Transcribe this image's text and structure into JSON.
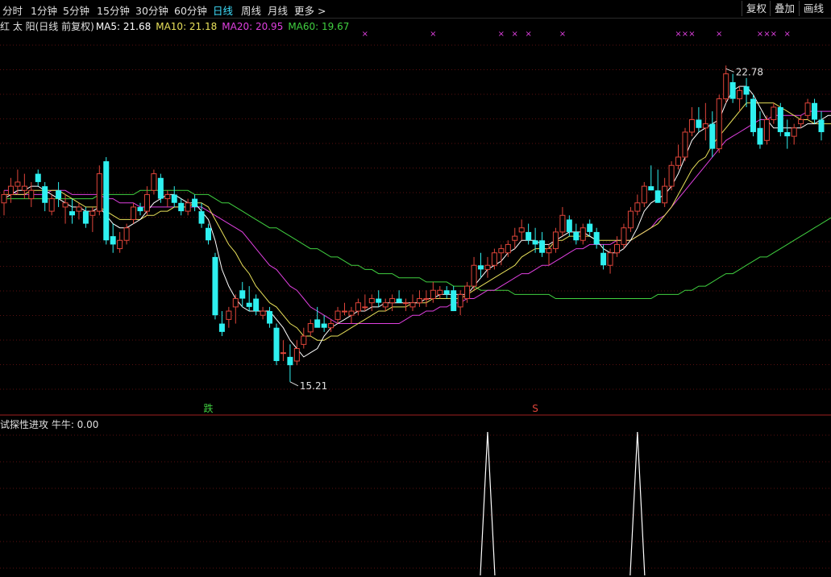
{
  "toolbar": {
    "timeframes": [
      "分时",
      "1分钟",
      "5分钟",
      "15分钟",
      "30分钟",
      "60分钟",
      "日线",
      "周线",
      "月线",
      "更多 >"
    ],
    "active": "日线",
    "right_buttons": [
      "复权",
      "叠加",
      "画线"
    ]
  },
  "main_legend": {
    "name": "红 太 阳(日线 前复权)",
    "ma5": "MA5: 21.68",
    "ma10": "MA10: 21.18",
    "ma20": "MA20: 20.95",
    "ma60": "MA60: 19.67"
  },
  "sub_legend": {
    "label": "试探性进攻 牛牛: 0.00"
  },
  "colors": {
    "up": "#e0453a",
    "down": "#2ef0f0",
    "ma5": "#ffffff",
    "ma10": "#e8e05a",
    "ma20": "#e040e0",
    "ma60": "#40d040",
    "marker": "#e040e0",
    "grid": "#5a1010"
  },
  "chart_data": {
    "type": "candlestick",
    "ylim": [
      14.5,
      23.6
    ],
    "high_label": "22.78",
    "low_label": "15.21",
    "signals": [
      {
        "label": "跌",
        "index": 30,
        "color": "#40d040"
      },
      {
        "label": "S",
        "index": 78,
        "color": "#e0453a"
      }
    ],
    "x_marks": [
      53,
      63,
      73,
      75,
      77,
      82,
      99,
      100,
      101,
      105,
      111,
      112,
      113,
      115
    ],
    "candles": [
      [
        19.5,
        19.8,
        19.2,
        19.7
      ],
      [
        19.7,
        20.1,
        19.5,
        19.9
      ],
      [
        19.9,
        20.3,
        19.7,
        20.0
      ],
      [
        19.8,
        20.2,
        19.6,
        19.9
      ],
      [
        19.6,
        20.0,
        19.4,
        19.8
      ],
      [
        20.2,
        20.3,
        19.9,
        20.0
      ],
      [
        19.9,
        20.0,
        19.3,
        19.5
      ],
      [
        19.3,
        19.7,
        19.2,
        19.6
      ],
      [
        19.8,
        20.0,
        19.4,
        19.6
      ],
      [
        19.4,
        19.7,
        19.0,
        19.5
      ],
      [
        19.3,
        19.6,
        19.0,
        19.2
      ],
      [
        19.3,
        19.5,
        19.1,
        19.4
      ],
      [
        19.3,
        19.4,
        18.9,
        19.0
      ],
      [
        19.2,
        19.4,
        18.8,
        19.3
      ],
      [
        19.3,
        20.4,
        19.2,
        20.2
      ],
      [
        20.5,
        20.6,
        18.5,
        18.6
      ],
      [
        18.7,
        19.0,
        18.3,
        18.5
      ],
      [
        18.4,
        18.8,
        18.3,
        18.6
      ],
      [
        18.6,
        19.0,
        18.5,
        18.9
      ],
      [
        19.1,
        19.5,
        19.0,
        19.4
      ],
      [
        19.4,
        19.5,
        19.2,
        19.3
      ],
      [
        19.3,
        19.9,
        19.2,
        19.7
      ],
      [
        19.8,
        20.3,
        19.7,
        20.2
      ],
      [
        20.1,
        20.2,
        19.5,
        19.6
      ],
      [
        19.6,
        19.8,
        19.4,
        19.7
      ],
      [
        19.7,
        19.9,
        19.4,
        19.5
      ],
      [
        19.5,
        19.6,
        19.2,
        19.3
      ],
      [
        19.3,
        19.6,
        19.2,
        19.5
      ],
      [
        19.6,
        19.7,
        19.3,
        19.4
      ],
      [
        19.3,
        19.5,
        18.9,
        19.0
      ],
      [
        18.9,
        19.0,
        18.5,
        18.6
      ],
      [
        18.2,
        18.3,
        16.7,
        16.8
      ],
      [
        16.6,
        16.9,
        16.3,
        16.4
      ],
      [
        16.7,
        17.0,
        16.5,
        16.9
      ],
      [
        17.0,
        17.3,
        16.6,
        17.2
      ],
      [
        17.4,
        17.6,
        17.0,
        17.2
      ],
      [
        17.1,
        17.5,
        16.9,
        17.0
      ],
      [
        17.2,
        17.3,
        16.8,
        16.9
      ],
      [
        16.8,
        17.0,
        16.7,
        16.9
      ],
      [
        16.9,
        17.0,
        16.5,
        16.6
      ],
      [
        16.5,
        16.6,
        15.6,
        15.7
      ],
      [
        15.9,
        16.2,
        15.7,
        15.9
      ],
      [
        15.8,
        16.1,
        15.2,
        15.6
      ],
      [
        15.7,
        16.2,
        15.6,
        16.0
      ],
      [
        16.1,
        16.5,
        16.0,
        16.3
      ],
      [
        16.4,
        16.7,
        16.3,
        16.6
      ],
      [
        16.7,
        17.0,
        16.6,
        16.5
      ],
      [
        16.6,
        16.8,
        16.4,
        16.5
      ],
      [
        16.5,
        16.7,
        16.4,
        16.6
      ],
      [
        16.7,
        17.0,
        16.6,
        16.9
      ],
      [
        16.9,
        17.1,
        16.8,
        16.9
      ],
      [
        16.8,
        17.0,
        16.6,
        16.9
      ],
      [
        16.9,
        17.2,
        16.8,
        17.1
      ],
      [
        17.0,
        17.3,
        16.9,
        17.0
      ],
      [
        17.1,
        17.3,
        16.9,
        17.2
      ],
      [
        17.2,
        17.4,
        17.0,
        17.1
      ],
      [
        17.0,
        17.2,
        16.9,
        17.1
      ],
      [
        17.1,
        17.3,
        16.9,
        17.2
      ],
      [
        17.2,
        17.4,
        17.1,
        17.1
      ],
      [
        17.1,
        17.2,
        16.9,
        17.1
      ],
      [
        17.0,
        17.3,
        16.9,
        17.1
      ],
      [
        17.1,
        17.4,
        17.0,
        17.2
      ],
      [
        17.2,
        17.4,
        17.0,
        17.2
      ],
      [
        17.2,
        17.6,
        17.1,
        17.4
      ],
      [
        17.3,
        17.5,
        17.2,
        17.4
      ],
      [
        17.4,
        17.5,
        17.2,
        17.3
      ],
      [
        17.4,
        17.5,
        16.9,
        16.9
      ],
      [
        17.0,
        17.4,
        16.8,
        17.3
      ],
      [
        17.2,
        17.6,
        17.1,
        17.5
      ],
      [
        17.5,
        18.2,
        17.4,
        18.0
      ],
      [
        18.0,
        18.3,
        17.7,
        17.9
      ],
      [
        17.9,
        18.2,
        17.7,
        18.0
      ],
      [
        18.0,
        18.4,
        17.9,
        18.3
      ],
      [
        18.3,
        18.5,
        18.0,
        18.4
      ],
      [
        18.3,
        18.6,
        18.2,
        18.5
      ],
      [
        18.6,
        18.9,
        18.4,
        18.7
      ],
      [
        18.8,
        19.1,
        18.6,
        18.9
      ],
      [
        18.8,
        19.0,
        18.5,
        18.6
      ],
      [
        18.6,
        18.9,
        18.3,
        18.5
      ],
      [
        18.6,
        18.8,
        18.2,
        18.3
      ],
      [
        18.3,
        18.5,
        18.0,
        18.4
      ],
      [
        18.4,
        18.9,
        18.3,
        18.8
      ],
      [
        18.8,
        19.4,
        18.7,
        19.2
      ],
      [
        19.1,
        19.2,
        18.7,
        18.8
      ],
      [
        18.8,
        19.0,
        18.5,
        18.6
      ],
      [
        18.6,
        19.0,
        18.5,
        18.9
      ],
      [
        19.0,
        19.1,
        18.7,
        18.8
      ],
      [
        18.8,
        18.9,
        18.4,
        18.5
      ],
      [
        18.3,
        18.5,
        17.9,
        18.0
      ],
      [
        18.0,
        18.4,
        17.8,
        18.3
      ],
      [
        18.3,
        18.7,
        18.2,
        18.5
      ],
      [
        18.5,
        19.0,
        18.4,
        18.9
      ],
      [
        18.9,
        19.4,
        18.8,
        19.3
      ],
      [
        19.3,
        19.7,
        19.2,
        19.5
      ],
      [
        19.5,
        20.0,
        19.4,
        19.9
      ],
      [
        19.9,
        20.4,
        19.8,
        19.8
      ],
      [
        19.8,
        20.3,
        19.5,
        19.5
      ],
      [
        19.5,
        20.1,
        19.4,
        19.9
      ],
      [
        19.9,
        20.5,
        19.8,
        20.4
      ],
      [
        20.4,
        20.9,
        20.3,
        20.6
      ],
      [
        20.6,
        21.3,
        20.5,
        21.2
      ],
      [
        21.2,
        21.8,
        21.1,
        21.5
      ],
      [
        21.5,
        21.8,
        21.2,
        21.3
      ],
      [
        21.3,
        21.9,
        21.0,
        21.4
      ],
      [
        21.4,
        21.7,
        20.6,
        20.8
      ],
      [
        20.8,
        22.1,
        20.7,
        22.0
      ],
      [
        22.0,
        22.8,
        21.9,
        22.6
      ],
      [
        22.4,
        22.6,
        21.9,
        22.0
      ],
      [
        22.0,
        22.3,
        21.7,
        22.2
      ],
      [
        22.3,
        22.5,
        21.8,
        22.1
      ],
      [
        22.0,
        22.1,
        21.1,
        21.2
      ],
      [
        21.3,
        21.7,
        20.8,
        20.9
      ],
      [
        21.0,
        21.6,
        20.9,
        21.5
      ],
      [
        21.5,
        21.9,
        21.4,
        21.8
      ],
      [
        21.8,
        21.9,
        21.1,
        21.2
      ],
      [
        21.2,
        21.5,
        20.8,
        21.1
      ],
      [
        21.1,
        21.4,
        20.9,
        21.3
      ],
      [
        21.4,
        21.6,
        21.3,
        21.5
      ],
      [
        21.6,
        22.0,
        21.5,
        21.9
      ],
      [
        21.9,
        22.0,
        21.4,
        21.5
      ],
      [
        21.5,
        21.7,
        21.0,
        21.2
      ]
    ],
    "ma5": [
      19.6,
      19.7,
      19.8,
      19.8,
      19.9,
      19.9,
      19.8,
      19.7,
      19.6,
      19.5,
      19.4,
      19.4,
      19.3,
      19.3,
      19.4,
      19.2,
      19.0,
      18.9,
      18.9,
      19.0,
      19.1,
      19.3,
      19.5,
      19.6,
      19.7,
      19.7,
      19.6,
      19.5,
      19.5,
      19.3,
      19.1,
      18.6,
      17.9,
      17.5,
      17.2,
      17.0,
      16.9,
      16.9,
      16.9,
      16.9,
      16.7,
      16.5,
      16.2,
      16.0,
      15.8,
      15.9,
      16.0,
      16.3,
      16.5,
      16.6,
      16.7,
      16.8,
      16.9,
      16.9,
      17.0,
      17.0,
      17.1,
      17.1,
      17.1,
      17.1,
      17.1,
      17.1,
      17.2,
      17.2,
      17.3,
      17.3,
      17.3,
      17.3,
      17.3,
      17.5,
      17.7,
      17.9,
      18.0,
      18.1,
      18.3,
      18.4,
      18.6,
      18.6,
      18.6,
      18.5,
      18.5,
      18.6,
      18.7,
      18.8,
      18.8,
      18.8,
      18.7,
      18.6,
      18.4,
      18.3,
      18.3,
      18.4,
      18.6,
      18.9,
      19.3,
      19.5,
      19.6,
      19.7,
      19.9,
      20.2,
      20.6,
      21.0,
      21.2,
      21.3,
      21.4,
      21.5,
      21.9,
      22.2,
      22.3,
      22.3,
      22.1,
      21.8,
      21.5,
      21.3,
      21.3,
      21.3,
      21.3,
      21.3,
      21.4,
      21.4,
      21.5,
      21.6,
      21.6
    ],
    "ma10": [
      19.7,
      19.7,
      19.7,
      19.7,
      19.8,
      19.8,
      19.8,
      19.8,
      19.8,
      19.7,
      19.6,
      19.5,
      19.4,
      19.4,
      19.4,
      19.3,
      19.2,
      19.1,
      19.1,
      19.1,
      19.1,
      19.2,
      19.2,
      19.3,
      19.3,
      19.4,
      19.4,
      19.4,
      19.5,
      19.5,
      19.4,
      19.1,
      18.8,
      18.5,
      18.3,
      18.0,
      17.8,
      17.5,
      17.3,
      17.1,
      17.0,
      16.8,
      16.6,
      16.5,
      16.3,
      16.3,
      16.2,
      16.2,
      16.3,
      16.3,
      16.4,
      16.5,
      16.6,
      16.7,
      16.8,
      16.9,
      16.9,
      17.0,
      17.0,
      17.0,
      17.1,
      17.1,
      17.1,
      17.2,
      17.2,
      17.2,
      17.2,
      17.2,
      17.3,
      17.4,
      17.5,
      17.6,
      17.7,
      17.8,
      17.9,
      18.0,
      18.2,
      18.3,
      18.4,
      18.4,
      18.4,
      18.6,
      18.6,
      18.7,
      18.7,
      18.7,
      18.7,
      18.6,
      18.6,
      18.6,
      18.6,
      18.6,
      18.6,
      18.7,
      18.8,
      18.9,
      19.0,
      19.2,
      19.4,
      19.7,
      20.0,
      20.3,
      20.5,
      20.6,
      20.9,
      21.1,
      21.3,
      21.5,
      21.7,
      21.9,
      21.9,
      21.9,
      21.9,
      21.9,
      21.8,
      21.7,
      21.6,
      21.5,
      21.5,
      21.4,
      21.4,
      21.4,
      21.4
    ],
    "ma20": [
      19.8,
      19.8,
      19.7,
      19.7,
      19.7,
      19.7,
      19.7,
      19.8,
      19.8,
      19.8,
      19.7,
      19.7,
      19.7,
      19.7,
      19.7,
      19.6,
      19.6,
      19.5,
      19.5,
      19.5,
      19.4,
      19.4,
      19.4,
      19.4,
      19.4,
      19.4,
      19.4,
      19.4,
      19.4,
      19.4,
      19.3,
      19.2,
      19.1,
      19.0,
      18.9,
      18.8,
      18.6,
      18.4,
      18.2,
      18.0,
      17.9,
      17.7,
      17.5,
      17.4,
      17.2,
      17.0,
      16.9,
      16.8,
      16.7,
      16.6,
      16.6,
      16.6,
      16.6,
      16.6,
      16.6,
      16.6,
      16.6,
      16.6,
      16.6,
      16.7,
      16.8,
      16.8,
      16.9,
      16.9,
      17.0,
      17.0,
      17.1,
      17.1,
      17.2,
      17.2,
      17.3,
      17.4,
      17.4,
      17.5,
      17.6,
      17.7,
      17.8,
      17.8,
      17.9,
      18.0,
      18.0,
      18.1,
      18.2,
      18.3,
      18.4,
      18.4,
      18.5,
      18.5,
      18.5,
      18.5,
      18.6,
      18.6,
      18.6,
      18.7,
      18.8,
      18.9,
      19.1,
      19.2,
      19.4,
      19.6,
      19.8,
      20.0,
      20.2,
      20.4,
      20.6,
      20.8,
      21.0,
      21.1,
      21.2,
      21.3,
      21.4,
      21.5,
      21.5,
      21.6,
      21.6,
      21.6,
      21.6,
      21.6,
      21.7,
      21.7,
      21.7,
      21.7,
      21.7
    ],
    "ma60": [
      19.6,
      19.6,
      19.6,
      19.6,
      19.6,
      19.6,
      19.6,
      19.6,
      19.6,
      19.6,
      19.6,
      19.6,
      19.6,
      19.6,
      19.7,
      19.7,
      19.7,
      19.7,
      19.7,
      19.7,
      19.8,
      19.8,
      19.8,
      19.8,
      19.8,
      19.8,
      19.8,
      19.8,
      19.7,
      19.7,
      19.7,
      19.6,
      19.5,
      19.5,
      19.4,
      19.3,
      19.2,
      19.1,
      19.0,
      18.9,
      18.9,
      18.8,
      18.7,
      18.6,
      18.5,
      18.4,
      18.4,
      18.3,
      18.2,
      18.2,
      18.1,
      18.0,
      18.0,
      17.9,
      17.9,
      17.8,
      17.8,
      17.8,
      17.7,
      17.7,
      17.7,
      17.7,
      17.6,
      17.6,
      17.6,
      17.6,
      17.5,
      17.5,
      17.5,
      17.5,
      17.4,
      17.4,
      17.4,
      17.4,
      17.4,
      17.3,
      17.3,
      17.3,
      17.3,
      17.3,
      17.3,
      17.2,
      17.2,
      17.2,
      17.2,
      17.2,
      17.2,
      17.2,
      17.2,
      17.2,
      17.2,
      17.2,
      17.2,
      17.2,
      17.2,
      17.2,
      17.3,
      17.3,
      17.3,
      17.3,
      17.4,
      17.4,
      17.5,
      17.5,
      17.6,
      17.7,
      17.8,
      17.8,
      17.9,
      18.0,
      18.1,
      18.2,
      18.2,
      18.3,
      18.4,
      18.5,
      18.6,
      18.7,
      18.8,
      18.9,
      19.0,
      19.1,
      19.2
    ],
    "indicator": {
      "name": "牛牛",
      "value": "0.00",
      "spikes": [
        {
          "index": 71,
          "value": 1
        },
        {
          "index": 93,
          "value": 1
        }
      ],
      "ylim": [
        0,
        1
      ]
    }
  }
}
